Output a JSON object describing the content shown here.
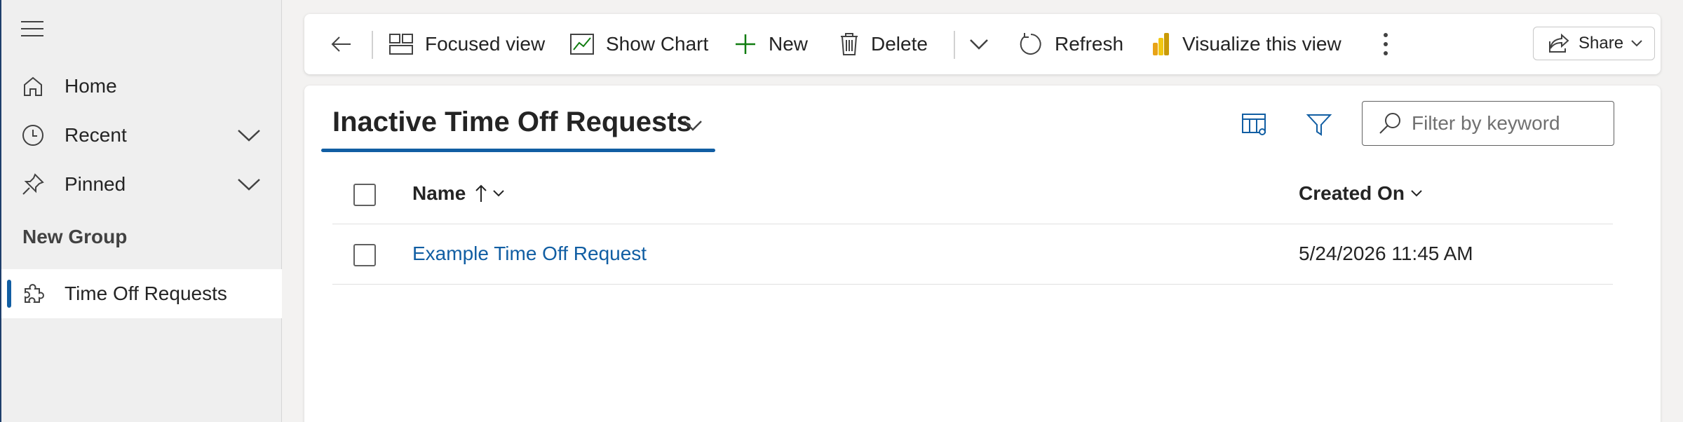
{
  "sidebar": {
    "items": [
      {
        "label": "Home",
        "icon": "home-icon"
      },
      {
        "label": "Recent",
        "icon": "clock-icon"
      },
      {
        "label": "Pinned",
        "icon": "pin-icon"
      }
    ],
    "group_title": "New Group",
    "group_items": [
      {
        "label": "Time Off Requests",
        "icon": "puzzle-icon",
        "active": true
      }
    ]
  },
  "commandbar": {
    "focused_view": "Focused view",
    "show_chart": "Show Chart",
    "new": "New",
    "delete": "Delete",
    "refresh": "Refresh",
    "visualize": "Visualize this view",
    "share": "Share"
  },
  "view": {
    "title": "Inactive Time Off Requests",
    "search_placeholder": "Filter by keyword"
  },
  "grid": {
    "columns": [
      {
        "label": "Name",
        "sort": "ascending"
      },
      {
        "label": "Created On"
      }
    ],
    "rows": [
      {
        "name": "Example Time Off Request",
        "created_on": "5/24/2026 11:45 AM"
      }
    ]
  },
  "colors": {
    "accent": "#115ea3",
    "new_green": "#107c10",
    "chart_green": "#107c10"
  }
}
